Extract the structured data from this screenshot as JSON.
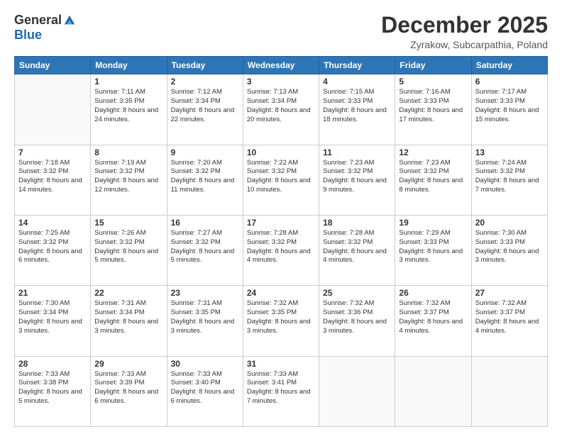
{
  "logo": {
    "general": "General",
    "blue": "Blue"
  },
  "header": {
    "month": "December 2025",
    "location": "Zyrakow, Subcarpathia, Poland"
  },
  "weekdays": [
    "Sunday",
    "Monday",
    "Tuesday",
    "Wednesday",
    "Thursday",
    "Friday",
    "Saturday"
  ],
  "weeks": [
    [
      {
        "day": null,
        "info": null
      },
      {
        "day": "1",
        "info": "Sunrise: 7:11 AM\nSunset: 3:35 PM\nDaylight: 8 hours and 24 minutes."
      },
      {
        "day": "2",
        "info": "Sunrise: 7:12 AM\nSunset: 3:34 PM\nDaylight: 8 hours and 22 minutes."
      },
      {
        "day": "3",
        "info": "Sunrise: 7:13 AM\nSunset: 3:34 PM\nDaylight: 8 hours and 20 minutes."
      },
      {
        "day": "4",
        "info": "Sunrise: 7:15 AM\nSunset: 3:33 PM\nDaylight: 8 hours and 18 minutes."
      },
      {
        "day": "5",
        "info": "Sunrise: 7:16 AM\nSunset: 3:33 PM\nDaylight: 8 hours and 17 minutes."
      },
      {
        "day": "6",
        "info": "Sunrise: 7:17 AM\nSunset: 3:33 PM\nDaylight: 8 hours and 15 minutes."
      }
    ],
    [
      {
        "day": "7",
        "info": "Sunrise: 7:18 AM\nSunset: 3:32 PM\nDaylight: 8 hours and 14 minutes."
      },
      {
        "day": "8",
        "info": "Sunrise: 7:19 AM\nSunset: 3:32 PM\nDaylight: 8 hours and 12 minutes."
      },
      {
        "day": "9",
        "info": "Sunrise: 7:20 AM\nSunset: 3:32 PM\nDaylight: 8 hours and 11 minutes."
      },
      {
        "day": "10",
        "info": "Sunrise: 7:22 AM\nSunset: 3:32 PM\nDaylight: 8 hours and 10 minutes."
      },
      {
        "day": "11",
        "info": "Sunrise: 7:23 AM\nSunset: 3:32 PM\nDaylight: 8 hours and 9 minutes."
      },
      {
        "day": "12",
        "info": "Sunrise: 7:23 AM\nSunset: 3:32 PM\nDaylight: 8 hours and 8 minutes."
      },
      {
        "day": "13",
        "info": "Sunrise: 7:24 AM\nSunset: 3:32 PM\nDaylight: 8 hours and 7 minutes."
      }
    ],
    [
      {
        "day": "14",
        "info": "Sunrise: 7:25 AM\nSunset: 3:32 PM\nDaylight: 8 hours and 6 minutes."
      },
      {
        "day": "15",
        "info": "Sunrise: 7:26 AM\nSunset: 3:32 PM\nDaylight: 8 hours and 5 minutes."
      },
      {
        "day": "16",
        "info": "Sunrise: 7:27 AM\nSunset: 3:32 PM\nDaylight: 8 hours and 5 minutes."
      },
      {
        "day": "17",
        "info": "Sunrise: 7:28 AM\nSunset: 3:32 PM\nDaylight: 8 hours and 4 minutes."
      },
      {
        "day": "18",
        "info": "Sunrise: 7:28 AM\nSunset: 3:32 PM\nDaylight: 8 hours and 4 minutes."
      },
      {
        "day": "19",
        "info": "Sunrise: 7:29 AM\nSunset: 3:33 PM\nDaylight: 8 hours and 3 minutes."
      },
      {
        "day": "20",
        "info": "Sunrise: 7:30 AM\nSunset: 3:33 PM\nDaylight: 8 hours and 3 minutes."
      }
    ],
    [
      {
        "day": "21",
        "info": "Sunrise: 7:30 AM\nSunset: 3:34 PM\nDaylight: 8 hours and 3 minutes."
      },
      {
        "day": "22",
        "info": "Sunrise: 7:31 AM\nSunset: 3:34 PM\nDaylight: 8 hours and 3 minutes."
      },
      {
        "day": "23",
        "info": "Sunrise: 7:31 AM\nSunset: 3:35 PM\nDaylight: 8 hours and 3 minutes."
      },
      {
        "day": "24",
        "info": "Sunrise: 7:32 AM\nSunset: 3:35 PM\nDaylight: 8 hours and 3 minutes."
      },
      {
        "day": "25",
        "info": "Sunrise: 7:32 AM\nSunset: 3:36 PM\nDaylight: 8 hours and 3 minutes."
      },
      {
        "day": "26",
        "info": "Sunrise: 7:32 AM\nSunset: 3:37 PM\nDaylight: 8 hours and 4 minutes."
      },
      {
        "day": "27",
        "info": "Sunrise: 7:32 AM\nSunset: 3:37 PM\nDaylight: 8 hours and 4 minutes."
      }
    ],
    [
      {
        "day": "28",
        "info": "Sunrise: 7:33 AM\nSunset: 3:38 PM\nDaylight: 8 hours and 5 minutes."
      },
      {
        "day": "29",
        "info": "Sunrise: 7:33 AM\nSunset: 3:39 PM\nDaylight: 8 hours and 6 minutes."
      },
      {
        "day": "30",
        "info": "Sunrise: 7:33 AM\nSunset: 3:40 PM\nDaylight: 8 hours and 6 minutes."
      },
      {
        "day": "31",
        "info": "Sunrise: 7:33 AM\nSunset: 3:41 PM\nDaylight: 8 hours and 7 minutes."
      },
      {
        "day": null,
        "info": null
      },
      {
        "day": null,
        "info": null
      },
      {
        "day": null,
        "info": null
      }
    ]
  ]
}
